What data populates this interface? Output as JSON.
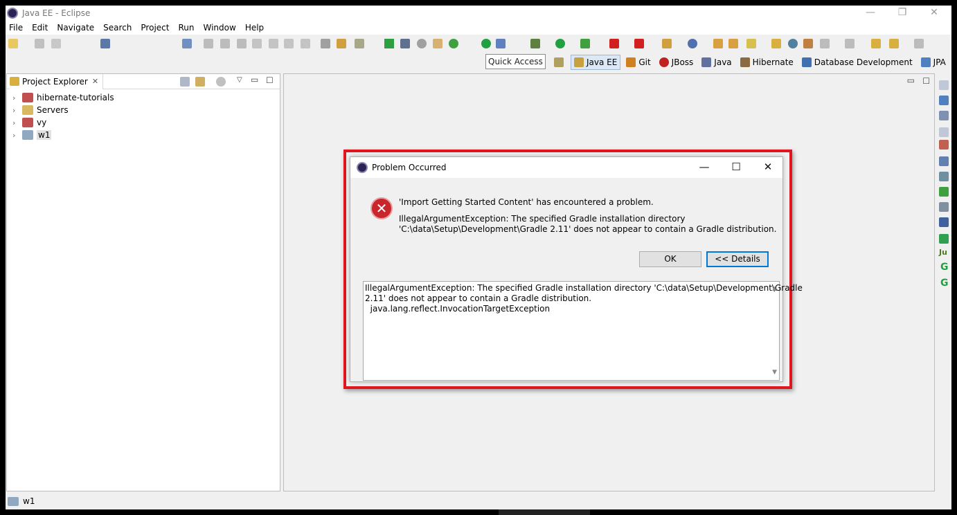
{
  "window": {
    "title": "Java EE - Eclipse",
    "minimize": "—",
    "restore": "❐",
    "close": "✕"
  },
  "menu": [
    "File",
    "Edit",
    "Navigate",
    "Search",
    "Project",
    "Run",
    "Window",
    "Help"
  ],
  "quick_access": "Quick Access",
  "perspectives": [
    {
      "label": "Java EE",
      "active": true,
      "color": "#c8a040"
    },
    {
      "label": "Git",
      "active": false,
      "color": "#d08020"
    },
    {
      "label": "JBoss",
      "active": false,
      "color": "#c02020"
    },
    {
      "label": "Java",
      "active": false,
      "color": "#6070a0"
    },
    {
      "label": "Hibernate",
      "active": false,
      "color": "#8a6a40"
    },
    {
      "label": "Database Development",
      "active": false,
      "color": "#4070b0"
    },
    {
      "label": "JPA",
      "active": false,
      "color": "#5080c0"
    }
  ],
  "explorer": {
    "tab_label": "Project Explorer",
    "items": [
      {
        "label": "hibernate-tutorials",
        "selected": false
      },
      {
        "label": "Servers",
        "selected": false
      },
      {
        "label": "vy",
        "selected": false
      },
      {
        "label": "w1",
        "selected": true
      }
    ]
  },
  "status": {
    "text": "w1"
  },
  "dialog": {
    "title": "Problem Occurred",
    "minimize": "—",
    "maximize": "☐",
    "close": "✕",
    "message1": "'Import Getting Started Content' has encountered a problem.",
    "message2": "IllegalArgumentException: The specified Gradle installation directory",
    "message3": "'C:\\data\\Setup\\Development\\Gradle 2.11' does not appear to contain a Gradle distribution.",
    "ok_label": "OK",
    "details_label": "<< Details",
    "details_lines": [
      "IllegalArgumentException: The specified Gradle installation directory 'C:\\data\\Setup\\Development\\Gradle",
      "2.11' does not appear to contain a Gradle distribution.",
      "  java.lang.reflect.InvocationTargetException"
    ]
  }
}
